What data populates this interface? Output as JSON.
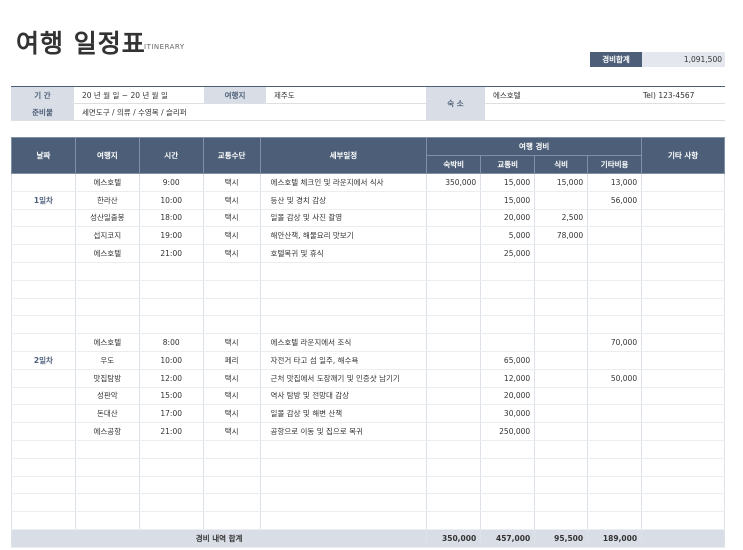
{
  "header": {
    "title": "여행 일정표",
    "subtitle": "ITINERARY"
  },
  "total": {
    "label": "경비합계",
    "value": "1,091,500"
  },
  "info": {
    "period_label": "기    간",
    "period_value": "20  년  월  일 ~ 20  년  월  일",
    "dest_label": "여행지",
    "dest_value": "제주도",
    "lodging_label": "숙    소",
    "lodging_value": "에스호텔",
    "tel": "Tel) 123-4567",
    "prep_label": "준비물",
    "prep_value": "세면도구 / 의류 / 수영복 / 슬리퍼"
  },
  "table": {
    "headers": {
      "date": "날짜",
      "place": "여행지",
      "time": "시간",
      "transport": "교통수단",
      "detail": "세부일정",
      "expense": "여행 경비",
      "lodging": "숙박비",
      "traffic": "교통비",
      "food": "식비",
      "other": "기타비용",
      "note": "기타 사항"
    },
    "days": [
      {
        "label": "1일차",
        "rows": [
          [
            "에스호텔",
            "9:00",
            "택시",
            "에스호텔 체크인 및 라운지에서 식사",
            "350,000",
            "15,000",
            "15,000",
            "13,000",
            ""
          ],
          [
            "한라산",
            "10:00",
            "택시",
            "등산 및 경치 감상",
            "",
            "15,000",
            "",
            "56,000",
            ""
          ],
          [
            "성산일출봉",
            "18:00",
            "택시",
            "일몰 감상 및 사진 촬영",
            "",
            "20,000",
            "2,500",
            "",
            ""
          ],
          [
            "섭지코지",
            "19:00",
            "택시",
            "해안산책, 해물요리 맛보기",
            "",
            "5,000",
            "78,000",
            "",
            ""
          ],
          [
            "에스호텔",
            "21:00",
            "택시",
            "호텔복귀 및 휴식",
            "",
            "25,000",
            "",
            "",
            ""
          ],
          [
            "",
            "",
            "",
            "",
            "",
            "",
            "",
            "",
            ""
          ],
          [
            "",
            "",
            "",
            "",
            "",
            "",
            "",
            "",
            ""
          ],
          [
            "",
            "",
            "",
            "",
            "",
            "",
            "",
            "",
            ""
          ],
          [
            "",
            "",
            "",
            "",
            "",
            "",
            "",
            "",
            ""
          ]
        ]
      },
      {
        "label": "2일차",
        "rows": [
          [
            "에스호텔",
            "8:00",
            "택시",
            "에스호텔 라운지에서 조식",
            "",
            "",
            "",
            "70,000",
            ""
          ],
          [
            "우도",
            "10:00",
            "페리",
            "자전거 타고 섬 일주, 해수욕",
            "",
            "65,000",
            "",
            "",
            ""
          ],
          [
            "맛집탐방",
            "12:00",
            "택시",
            "근처 맛집에서 도장깨기 및 인증샷 남기기",
            "",
            "12,000",
            "",
            "50,000",
            ""
          ],
          [
            "성판악",
            "15:00",
            "택시",
            "역사 탐방 및 전망대 감상",
            "",
            "20,000",
            "",
            "",
            ""
          ],
          [
            "돈대산",
            "17:00",
            "택시",
            "일몰 감상 및 해변 산책",
            "",
            "30,000",
            "",
            "",
            ""
          ],
          [
            "에스공항",
            "21:00",
            "택시",
            "공항으로 이동 및 집으로 복귀",
            "",
            "250,000",
            "",
            "",
            ""
          ],
          [
            "",
            "",
            "",
            "",
            "",
            "",
            "",
            "",
            ""
          ],
          [
            "",
            "",
            "",
            "",
            "",
            "",
            "",
            "",
            ""
          ],
          [
            "",
            "",
            "",
            "",
            "",
            "",
            "",
            "",
            ""
          ],
          [
            "",
            "",
            "",
            "",
            "",
            "",
            "",
            "",
            ""
          ],
          [
            "",
            "",
            "",
            "",
            "",
            "",
            "",
            "",
            ""
          ]
        ]
      }
    ],
    "footer": {
      "label": "경비 내역 합계",
      "lodging": "350,000",
      "traffic": "457,000",
      "food": "95,500",
      "other": "189,000"
    }
  }
}
